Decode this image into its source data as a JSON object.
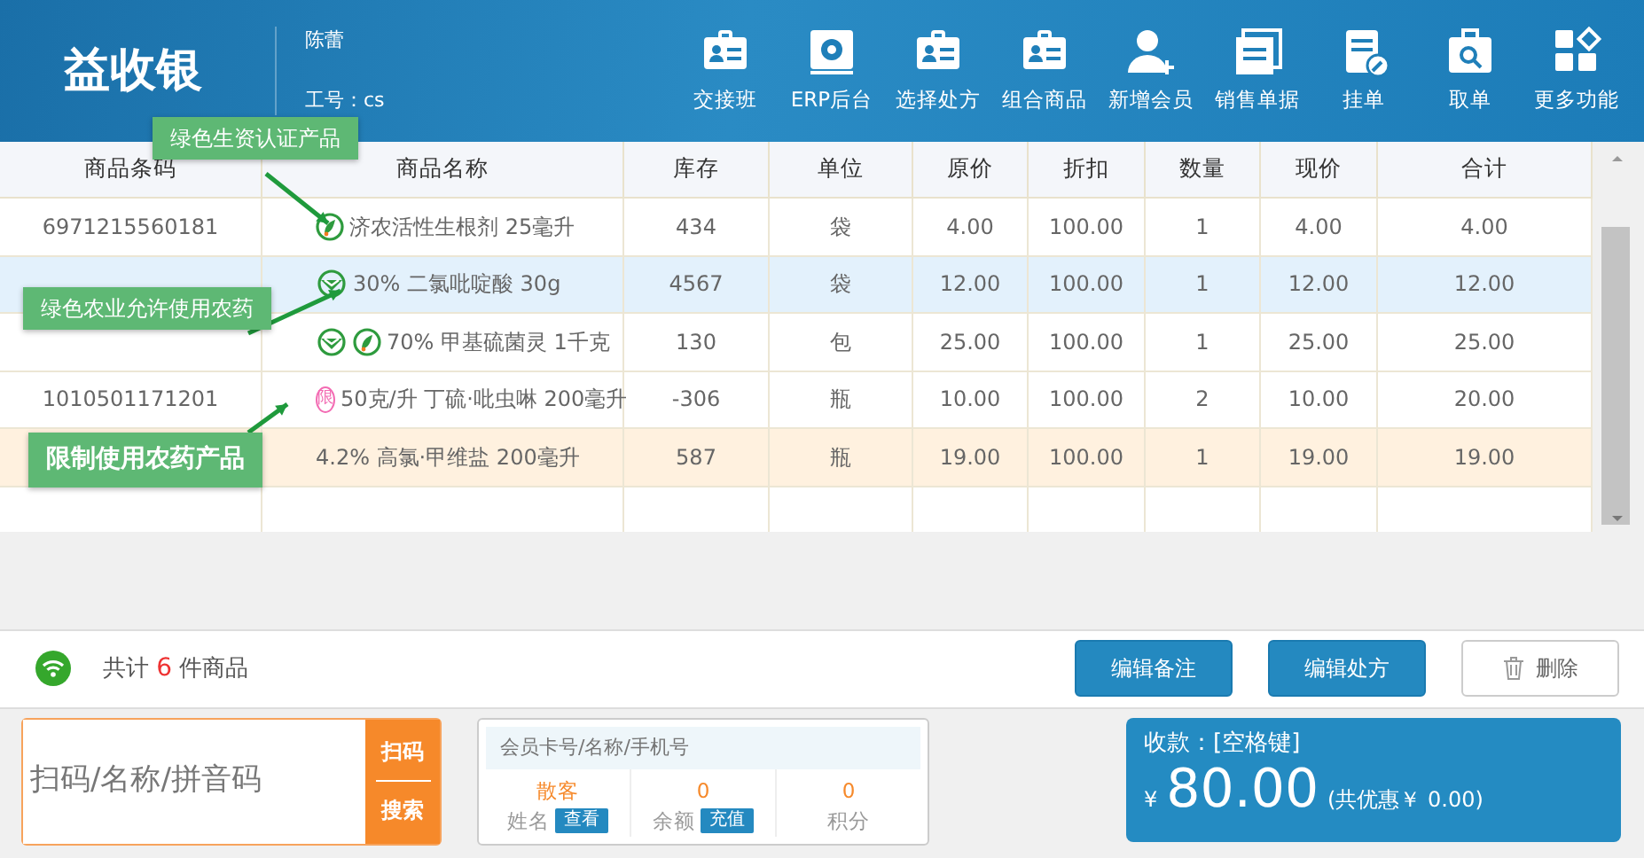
{
  "header": {
    "logo": "益收银",
    "cashier": "陈蕾",
    "staff_id": "工号：cs",
    "tools": [
      {
        "kind": "card",
        "label": "交接班"
      },
      {
        "kind": "gear",
        "label": "ERP后台"
      },
      {
        "kind": "card",
        "label": "选择处方"
      },
      {
        "kind": "card",
        "label": "组合商品"
      },
      {
        "kind": "user-add",
        "label": "新增会员"
      },
      {
        "kind": "docs",
        "label": "销售单据"
      },
      {
        "kind": "edit",
        "label": "挂单"
      },
      {
        "kind": "search",
        "label": "取单"
      },
      {
        "kind": "grid",
        "label": "更多功能"
      }
    ]
  },
  "table": {
    "columns": [
      "商品条码",
      "商品名称",
      "库存",
      "单位",
      "原价",
      "折扣",
      "数量",
      "现价",
      "合计"
    ],
    "rows": [
      {
        "selected": false,
        "marked": false,
        "badges": [
          {
            "kind": "leaf"
          }
        ],
        "cells": [
          "6971215560181",
          "济农活性生根剂 25毫升",
          "434",
          "袋",
          "4.00",
          "100.00",
          "1",
          "4.00",
          "4.00"
        ]
      },
      {
        "selected": true,
        "marked": false,
        "badges": [
          {
            "kind": "shield"
          }
        ],
        "cells": [
          "",
          "30% 二氯吡啶酸 30g",
          "4567",
          "袋",
          "12.00",
          "100.00",
          "1",
          "12.00",
          "12.00"
        ]
      },
      {
        "selected": false,
        "marked": false,
        "badges": [
          {
            "kind": "shield"
          },
          {
            "kind": "leaf"
          }
        ],
        "cells": [
          "",
          "70% 甲基硫菌灵 1千克",
          "130",
          "包",
          "25.00",
          "100.00",
          "1",
          "25.00",
          "25.00"
        ]
      },
      {
        "selected": false,
        "marked": false,
        "badges": [
          {
            "kind": "restricted",
            "text": "限"
          }
        ],
        "cells": [
          "1010501171201",
          "50克/升 丁硫·吡虫啉 200毫升",
          "-306",
          "瓶",
          "10.00",
          "100.00",
          "2",
          "10.00",
          "20.00"
        ]
      },
      {
        "selected": false,
        "marked": true,
        "badges": [],
        "cells": [
          "",
          "4.2% 高氯·甲维盐 200毫升",
          "587",
          "瓶",
          "19.00",
          "100.00",
          "1",
          "19.00",
          "19.00"
        ]
      }
    ]
  },
  "callouts": [
    {
      "text": "绿色生资认证产品"
    },
    {
      "text": "绿色农业允许使用农药"
    },
    {
      "text": "限制使用农药产品"
    }
  ],
  "summary": {
    "label": "共计",
    "count": "6",
    "unit": "件商品"
  },
  "actions": [
    {
      "kind": "primary",
      "label": "编辑备注"
    },
    {
      "kind": "primary",
      "label": "编辑处方"
    },
    {
      "kind": "delete",
      "label": "删除"
    }
  ],
  "scan": {
    "placeholder": "扫码/名称/拼音码",
    "button_top": "扫码",
    "button_bottom": "搜索"
  },
  "member": {
    "placeholder": "会员卡号/名称/手机号",
    "stats": [
      {
        "value": "散客",
        "label": "姓名",
        "action": "查看"
      },
      {
        "value": "0",
        "label": "余额",
        "action": "充值"
      },
      {
        "value": "0",
        "label": "积分"
      }
    ]
  },
  "payment": {
    "title": "收款：[空格键]",
    "currency": "¥",
    "amount": "80.00",
    "discount": "(共优惠￥ 0.00)"
  }
}
